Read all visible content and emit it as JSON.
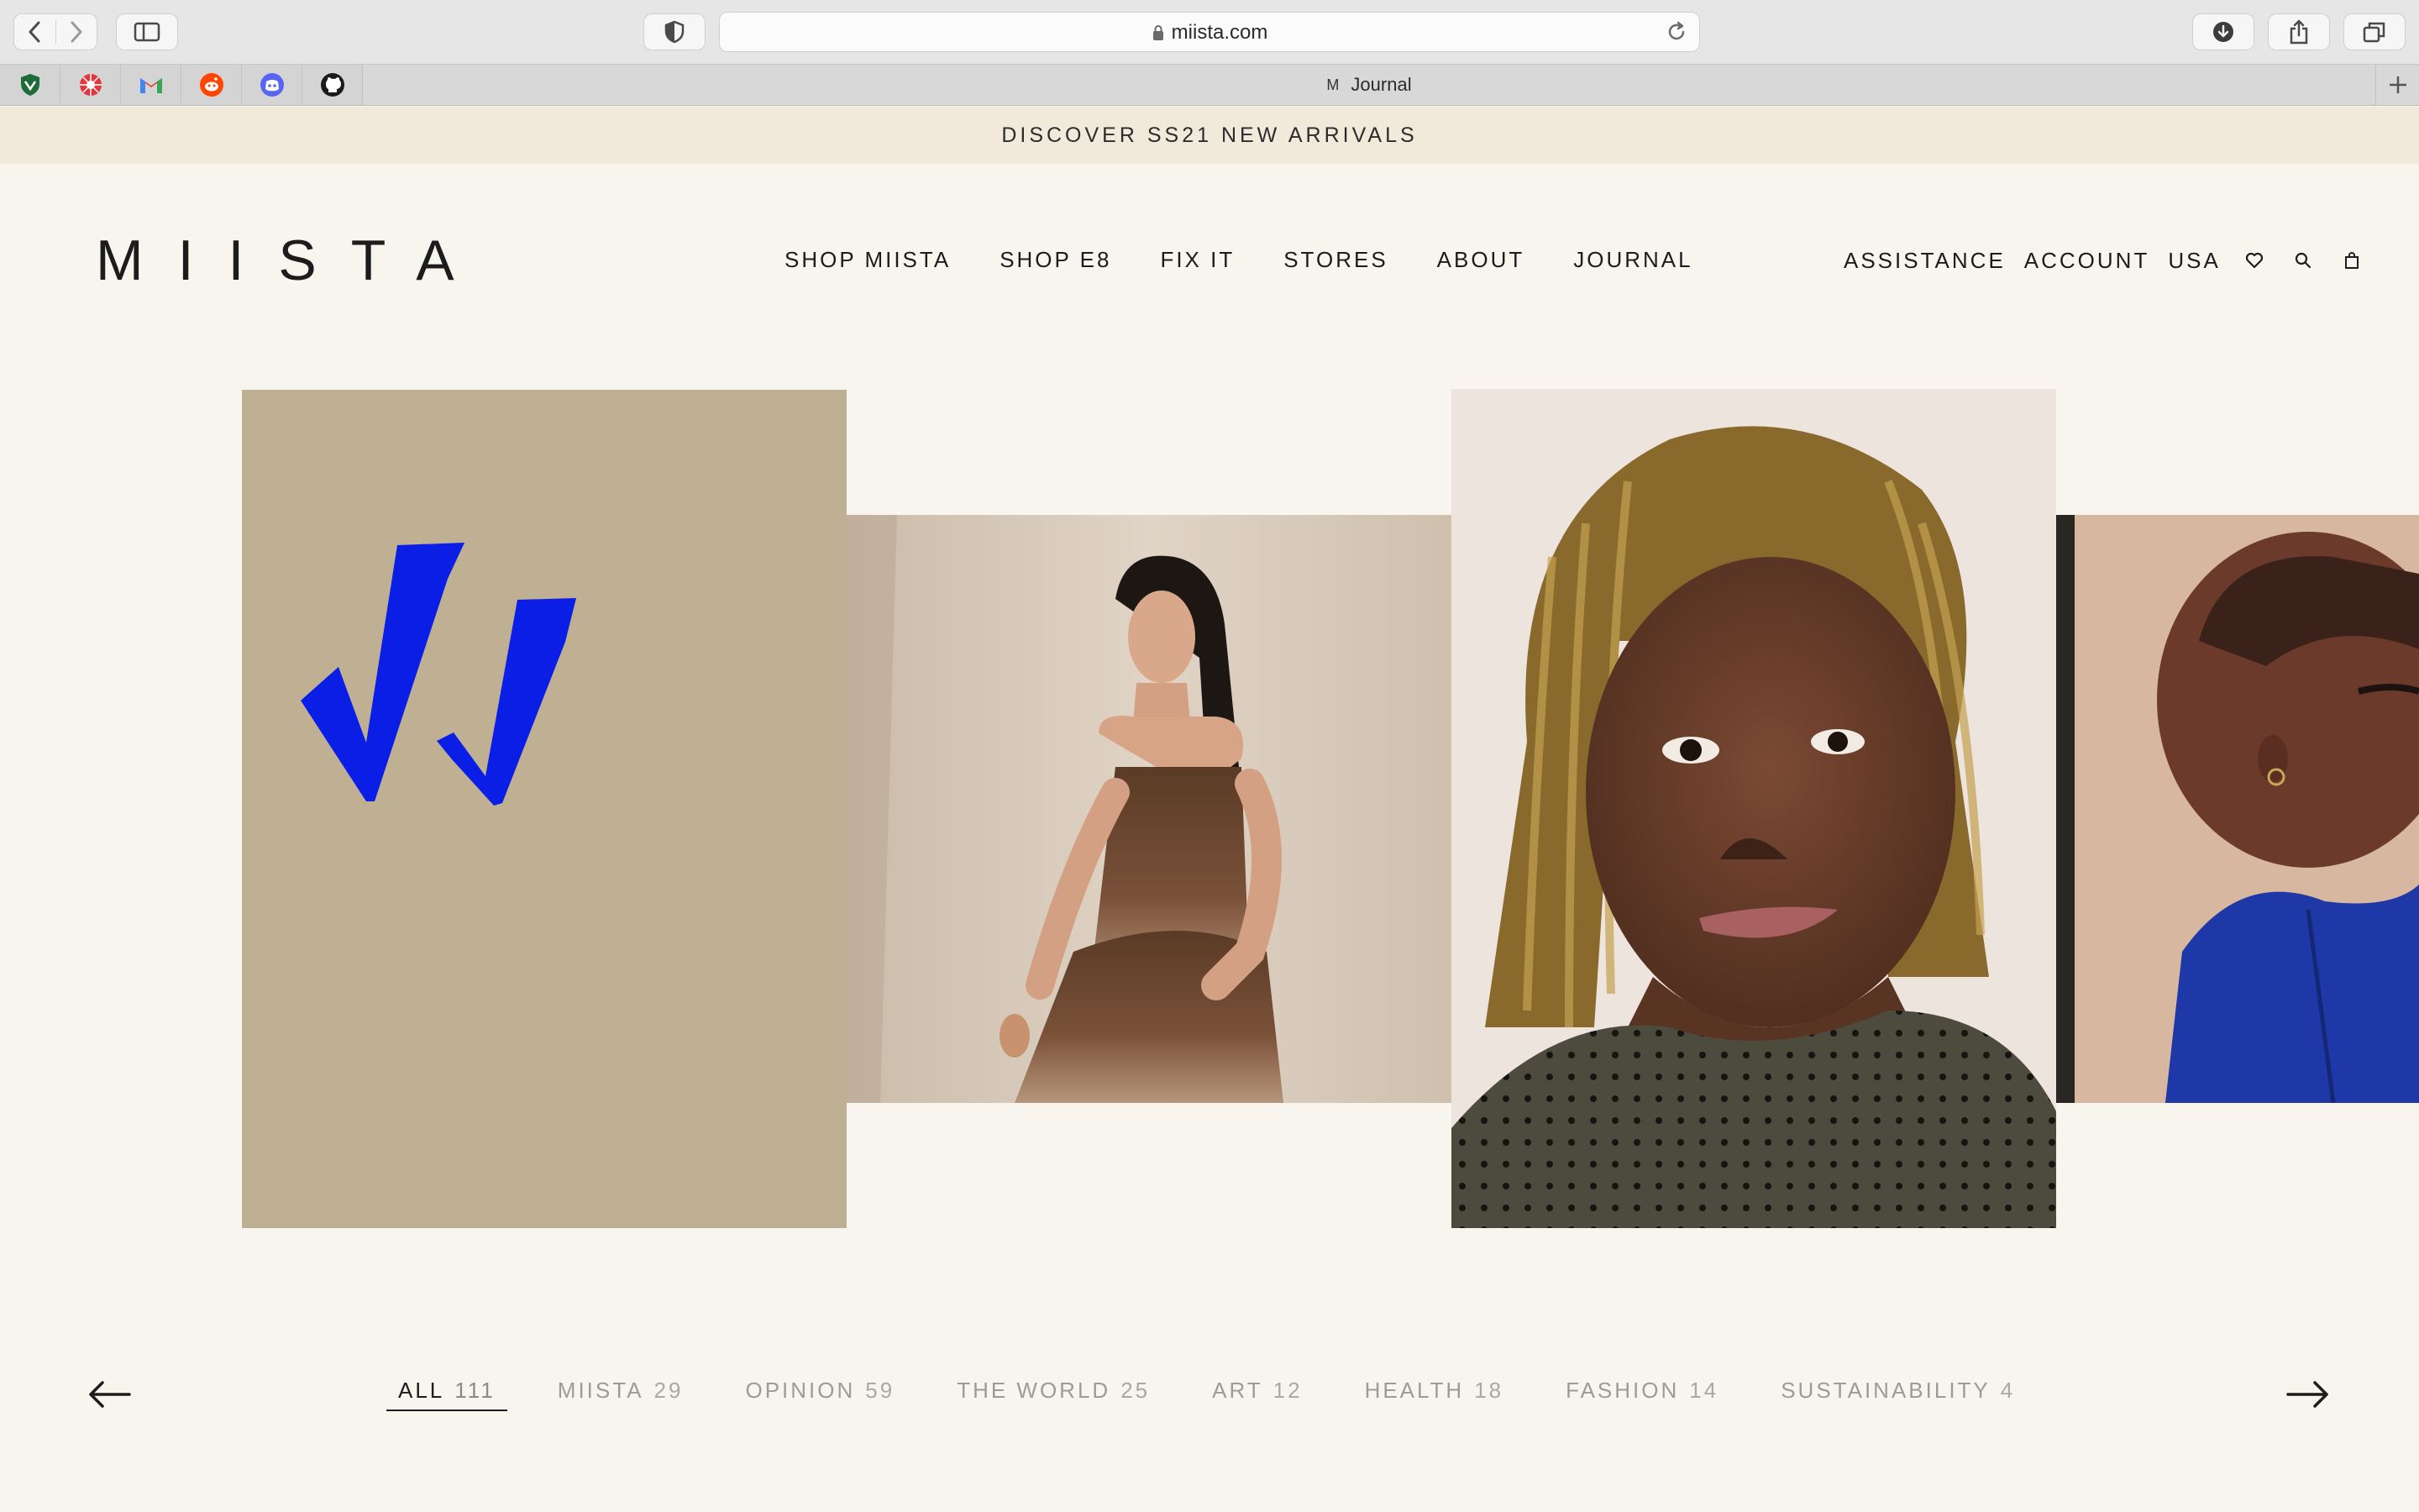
{
  "browser": {
    "url": "miista.com",
    "tab_title": "Journal",
    "tab_favicon": "M",
    "pinned_tabs": [
      "shield-favicon-icon",
      "pinwheel-favicon-icon",
      "gmail-favicon-icon",
      "reddit-favicon-icon",
      "discord-favicon-icon",
      "github-favicon-icon"
    ]
  },
  "promo": {
    "text": "DISCOVER SS21 NEW ARRIVALS"
  },
  "header": {
    "logo": "MIISTA",
    "nav": [
      "SHOP MIISTA",
      "SHOP E8",
      "FIX IT",
      "STORES",
      "ABOUT",
      "JOURNAL"
    ],
    "util": [
      "ASSISTANCE",
      "ACCOUNT",
      "USA"
    ]
  },
  "carousel": {
    "cards": [
      "vv-logo-card",
      "woman-strapless-dress-photo",
      "woman-braids-portrait-photo",
      "woman-blue-shirt-photo"
    ]
  },
  "categories": [
    {
      "label": "ALL",
      "count": "111",
      "active": true
    },
    {
      "label": "MIISTA",
      "count": "29"
    },
    {
      "label": "OPINION",
      "count": "59"
    },
    {
      "label": "THE WORLD",
      "count": "25"
    },
    {
      "label": "ART",
      "count": "12"
    },
    {
      "label": "HEALTH",
      "count": "18"
    },
    {
      "label": "FASHION",
      "count": "14"
    },
    {
      "label": "SUSTAINABILITY",
      "count": "4"
    }
  ],
  "colors": {
    "accent_blue": "#0a1ee6",
    "background": "#f8f5ee",
    "promo_bg": "#f1e9da",
    "card_tan": "#bfaf93"
  }
}
